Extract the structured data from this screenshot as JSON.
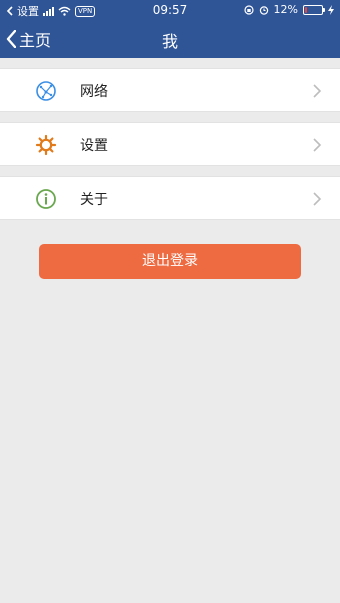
{
  "status_bar": {
    "carrier_back": "设置",
    "vpn": "VPN",
    "time": "09:57",
    "battery_percent": "12%",
    "battery_level": 0.12,
    "battery_color": "#e8453c"
  },
  "nav": {
    "back_label": "主页",
    "title": "我",
    "bar_color": "#2f5597"
  },
  "menu": [
    {
      "label": "网络",
      "icon": "globe-icon",
      "icon_color": "#3a8ee6"
    },
    {
      "label": "设置",
      "icon": "gear-icon",
      "icon_color": "#e07a1a"
    },
    {
      "label": "关于",
      "icon": "info-icon",
      "icon_color": "#6aa84f"
    }
  ],
  "logout_button": {
    "label": "退出登录",
    "color": "#ee6a41"
  }
}
